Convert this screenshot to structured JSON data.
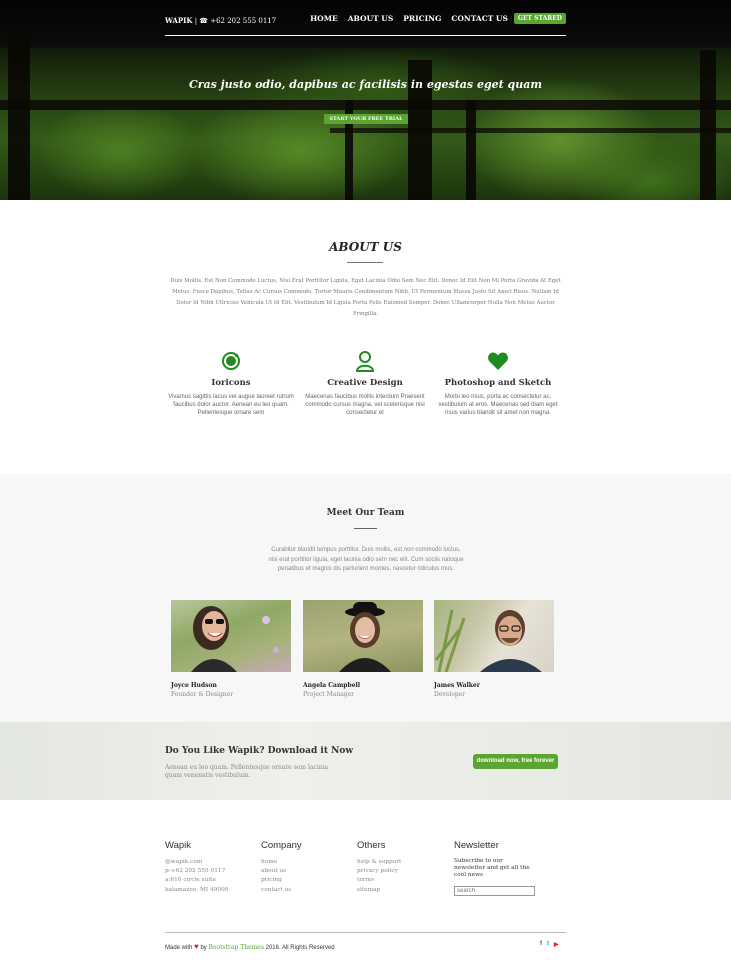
{
  "nav": {
    "brand": "WAPIK",
    "phone": " | ☎ +62 202 555 0117",
    "items": [
      {
        "label": "HOME"
      },
      {
        "label": "ABOUT US"
      },
      {
        "label": "PRICING"
      },
      {
        "label": "CONTACT US"
      }
    ],
    "cta": "GET STARED"
  },
  "hero": {
    "title": "Cras justo odio, dapibus ac facilisis in egestas eget quam",
    "button": "START YOUR FREE TRIAL"
  },
  "about": {
    "title": "ABOUT US",
    "text": "Duis Mollis, Est Non Commodo Luctus, Nisi Erat Porttitor Ligula, Eget Lacinia Odio Sem Nec Elit. Donec Id Elit Non Mi Porta Gravida At Eget Metus. Fusce Dapibus, Tellus Ac Cursus Commodo, Tortor Mauris Condimentum Nibh, Ut Fermentum Massa Justo Sit Amet Risus. Nullam Id Dolor Id Nibh Ultricies Vehicula Ut Id Elit. Vestibulum Id Ligula Porta Felis Euismod Semper. Donec Ullamcorper Nulla Non Metus Auctor Fringilla.",
    "features": [
      {
        "icon": "ionic-icon",
        "title": "Ioricons",
        "text": "Vivamus sagittis lacus vel augue laoreet rutrum faucibus dolor auctor. Aenean eu leo quam. Pellentesque ornare sem"
      },
      {
        "icon": "user-icon",
        "title": "Creative Design",
        "text": "Maecenas faucibus mollis interdum Praesent commodo cursus magna, vel scelerisque nisl consectetur et"
      },
      {
        "icon": "heart-icon",
        "title": "Photoshop and Sketch",
        "text": "Morbi leo risus, porta ac consectetur ac, vestibulum at eros. Maecenas sed diam eget risus varius blandit sit amet non magna."
      }
    ]
  },
  "team": {
    "title": "Meet Our Team",
    "text": "Curabitur blandit tempus porttitor. Duis mollis, est non commodo luctus, nisi erat porttitor ligula, eget lacinia odio sem nec elit. Cum sociis natoque penatibus et magnis dis parturient montes, nascetur ridiculus mus.",
    "members": [
      {
        "name": "Joyce Hudson",
        "role": "Founder & Designer"
      },
      {
        "name": "Angela Campbell",
        "role": "Project Manager"
      },
      {
        "name": "James Walker",
        "role": "Developer"
      }
    ]
  },
  "cta_band": {
    "title": "Do You Like Wapik? Download it Now",
    "text": "Aenean eu leo quam. Pellentesque ornare sem lacinia quam venenatis vestibulum.",
    "button": "download now, free forever"
  },
  "footer": {
    "col1": {
      "title": "Wapik",
      "lines": [
        "@wapik.com",
        "p:+62 202 555 0117",
        "a:610 circle suite",
        "kalamazoo, MI 49009"
      ]
    },
    "col2": {
      "title": "Company",
      "links": [
        "home",
        "about us",
        "pricing",
        "contact us"
      ]
    },
    "col3": {
      "title": "Others",
      "links": [
        "help & support",
        "privacy policy",
        "terms",
        "sitemap"
      ]
    },
    "col4": {
      "title": "Newsletter",
      "text": "Subscribe to our newsletter and get all the cool news",
      "search_placeholder": "search"
    },
    "copy_prefix": "Made with",
    "copy_by": "by",
    "copy_link": "Bootstrap Themes",
    "copy_suffix": "2016. All Rights Reserved",
    "socials": [
      {
        "icon": "facebook-icon",
        "glyph": "f",
        "color": "#3b5998"
      },
      {
        "icon": "twitter-icon",
        "glyph": "t",
        "color": "#1da1f2"
      },
      {
        "icon": "youtube-icon",
        "glyph": "▶",
        "color": "#e52d27"
      }
    ]
  },
  "colors": {
    "accent": "#5aa631",
    "icon_green": "#1e8c1e"
  }
}
